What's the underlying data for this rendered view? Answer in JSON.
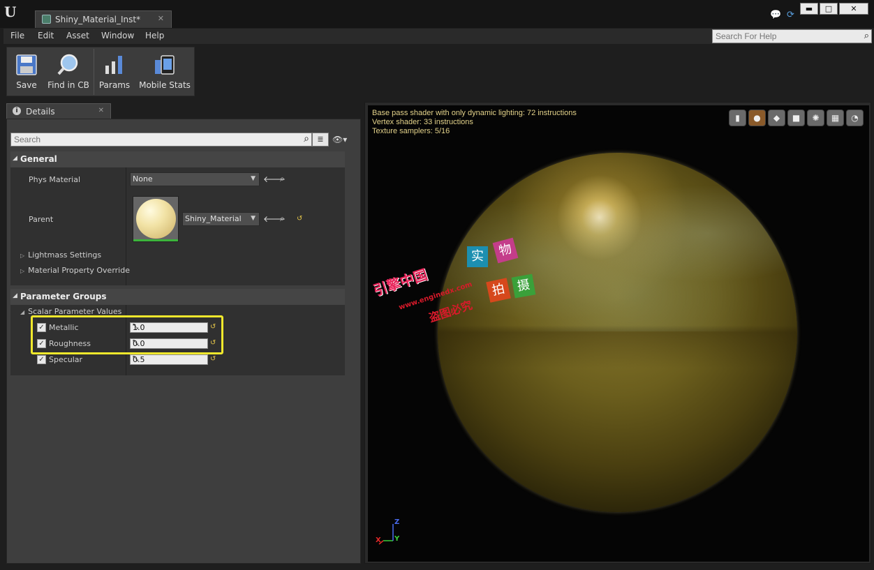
{
  "window": {
    "tab_title": "Shiny_Material_Inst*",
    "close_glyph": "✕",
    "minimize_glyph": "▬",
    "maximize_glyph": "□",
    "logo_text": "U"
  },
  "menu": {
    "items": [
      "File",
      "Edit",
      "Asset",
      "Window",
      "Help"
    ],
    "help_search_placeholder": "Search For Help"
  },
  "toolbar": {
    "save": "Save",
    "find_in_cb": "Find in CB",
    "params": "Params",
    "mobile_stats": "Mobile Stats"
  },
  "details": {
    "tab_label": "Details",
    "search_placeholder": "Search",
    "general": {
      "title": "General",
      "phys_material_label": "Phys Material",
      "phys_material_value": "None",
      "parent_label": "Parent",
      "parent_value": "Shiny_Material",
      "lightmass_settings": "Lightmass Settings",
      "material_property_override": "Material Property Override"
    },
    "parameter_groups": {
      "title": "Parameter Groups",
      "scalar_parameter_values": "Scalar Parameter Values",
      "params": [
        {
          "label": "Metallic",
          "value": "1.0",
          "checked": true
        },
        {
          "label": "Roughness",
          "value": "0.0",
          "checked": true
        },
        {
          "label": "Specular",
          "value": "0.5",
          "checked": true
        }
      ]
    }
  },
  "viewport": {
    "stats": [
      "Base pass shader with only dynamic lighting: 72 instructions",
      "Vertex shader: 33 instructions",
      "Texture samplers: 5/16"
    ],
    "axis_labels": {
      "z": "Z",
      "y": "Y",
      "x": "X"
    }
  },
  "watermark": {
    "brand": "引擎中国",
    "url": "www.enginedx.com",
    "notice": "盗图必究",
    "chars": [
      "实",
      "物",
      "拍",
      "摄"
    ]
  },
  "colors": {
    "highlight": "#f0e82c",
    "stats_text": "#e3d28a"
  }
}
